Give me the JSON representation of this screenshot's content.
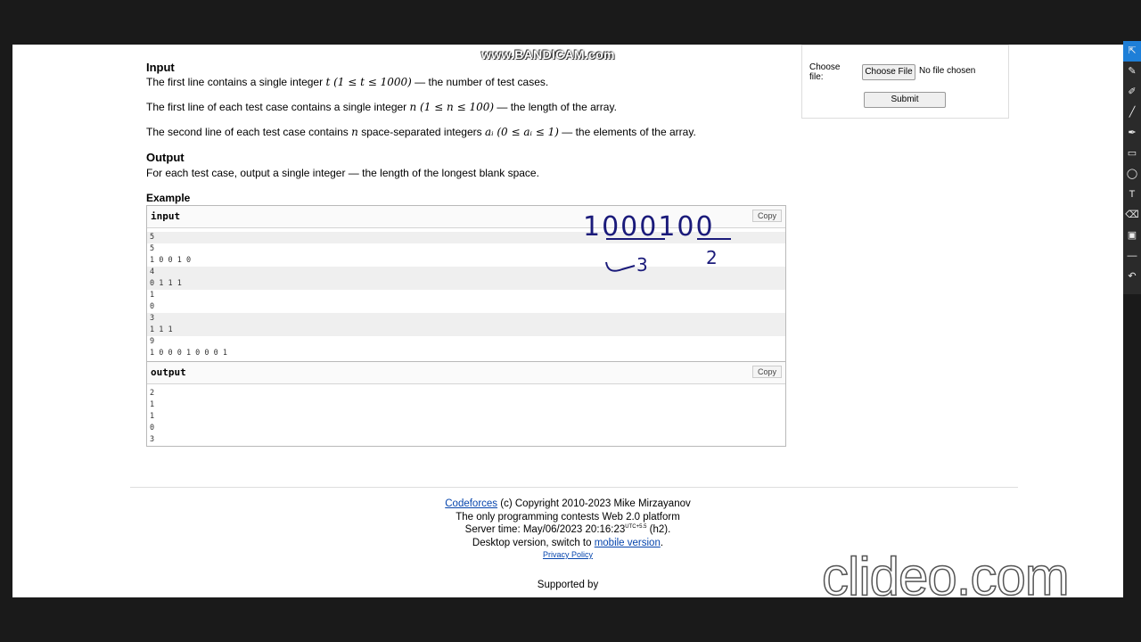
{
  "watermarks": {
    "top": "www.BANDICAM.com",
    "bottom": "clideo.com"
  },
  "input_section": {
    "title": "Input",
    "p1_pre": "The first line contains a single integer ",
    "p1_math": "t (1 ≤ t ≤ 1000)",
    "p1_post": " — the number of test cases.",
    "p2_pre": "The first line of each test case contains a single integer ",
    "p2_math": "n (1 ≤ n ≤ 100)",
    "p2_post": " — the length of the array.",
    "p3_pre": "The second line of each test case contains ",
    "p3_math1": "n",
    "p3_mid": " space-separated integers ",
    "p3_math2": "aᵢ (0 ≤ aᵢ ≤ 1)",
    "p3_post": " — the elements of the array."
  },
  "output_section": {
    "title": "Output",
    "p1": "For each test case, output a single integer — the length of the longest blank space."
  },
  "example": {
    "title": "Example",
    "input_label": "input",
    "output_label": "output",
    "copy_label": "Copy",
    "input_lines": [
      "5",
      "5",
      "1 0 0 1 0",
      "4",
      "0 1 1 1",
      "1",
      "0",
      "3",
      "1 1 1",
      "9",
      "1 0 0 0 1 0 0 0 1"
    ],
    "output_lines": [
      "2",
      "1",
      "1",
      "0",
      "3"
    ]
  },
  "annotation": {
    "digits": "1000100",
    "under_left": "3",
    "under_right": "2"
  },
  "submit_panel": {
    "choose_label": "Choose\nfile:",
    "choose_button": "Choose File",
    "file_status": "No file chosen",
    "submit_button": "Submit"
  },
  "footer": {
    "link1": "Codeforces",
    "line1_rest": " (c) Copyright 2010-2023 Mike Mirzayanov",
    "line2": "The only programming contests Web 2.0 platform",
    "line3_pre": "Server time: May/06/2023 20:16:23",
    "line3_sup": "UTC+5.5",
    "line3_post": " (h2).",
    "line4_pre": "Desktop version, switch to ",
    "line4_link": "mobile version",
    "line4_post": ".",
    "privacy": "Privacy Policy",
    "supported": "Supported by"
  },
  "tools": [
    "pointer-icon",
    "pencil-icon",
    "marker-icon",
    "line-icon",
    "pen-icon",
    "rectangle-icon",
    "ellipse-icon",
    "text-icon",
    "eraser-icon",
    "screenshot-icon",
    "minus-icon",
    "undo-icon"
  ]
}
